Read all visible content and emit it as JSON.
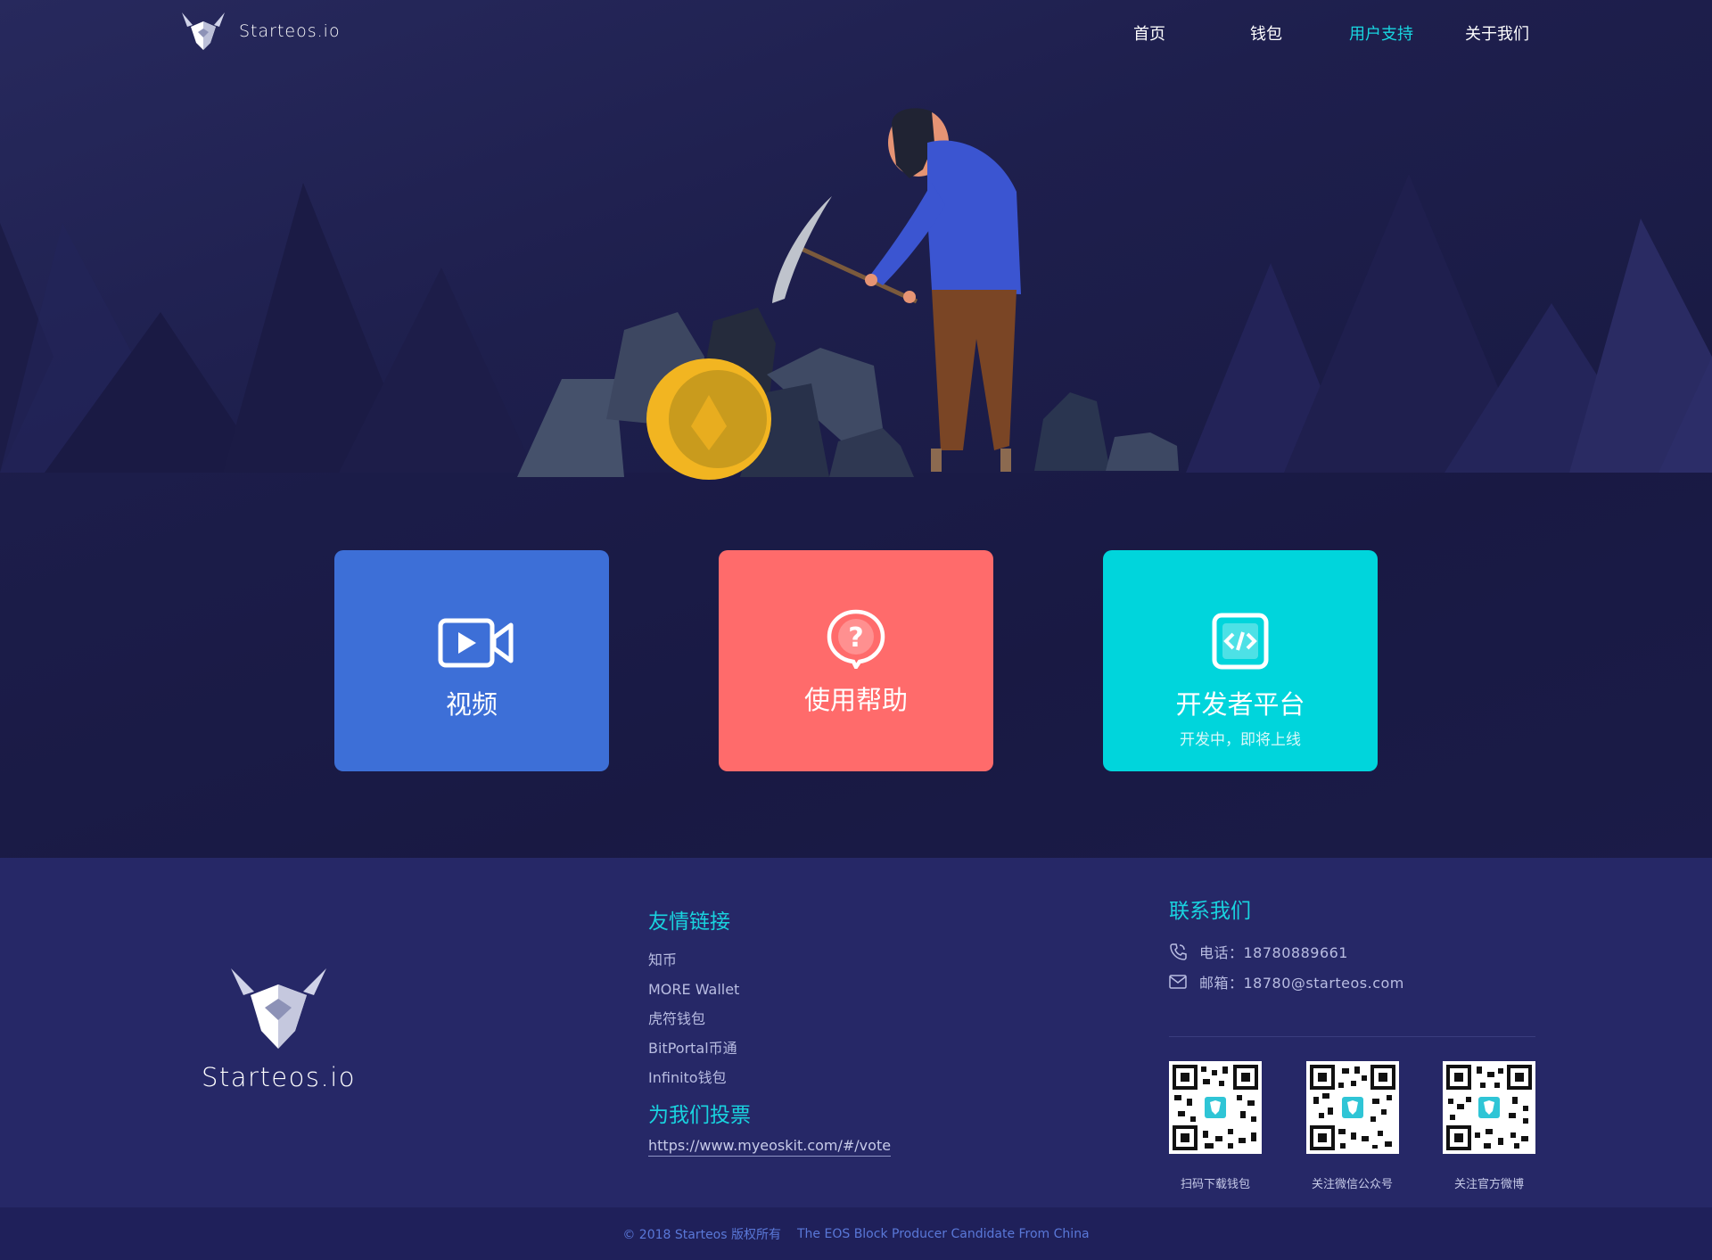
{
  "brand": {
    "name": "Starteos.io"
  },
  "nav": {
    "items": [
      {
        "label": "首页"
      },
      {
        "label": "钱包"
      },
      {
        "label": "用户支持"
      },
      {
        "label": "关于我们"
      }
    ],
    "active_index": 2,
    "active_color": "#18d6e0"
  },
  "cards": [
    {
      "label": "视频",
      "icon": "video-camera-icon",
      "color": "#3d6fd7"
    },
    {
      "label": "使用帮助",
      "icon": "question-bubble-icon",
      "color": "#ff6b6b"
    },
    {
      "label": "开发者平台",
      "sub": "开发中，即将上线",
      "icon": "code-icon",
      "color": "#00d5dc"
    }
  ],
  "footer": {
    "brand": "Starteos.io",
    "links_title": "友情链接",
    "links": [
      "知币",
      "MORE Wallet",
      "虎符钱包",
      "BitPortal币通",
      "Infinito钱包"
    ],
    "vote_title": "为我们投票",
    "vote_url": "https://www.myeoskit.com/#/vote",
    "contact_title": "联系我们",
    "phone": "电话：18780889661",
    "email": "邮箱：18780@starteos.com",
    "qr_codes": [
      {
        "label": "扫码下载钱包"
      },
      {
        "label": "关注微信公众号"
      },
      {
        "label": "关注官方微博"
      }
    ],
    "accent_color": "#19d3df"
  },
  "bottom": {
    "copyright": "© 2018 Starteos 版权所有",
    "tagline": "The EOS Block Producer Candidate From China"
  }
}
